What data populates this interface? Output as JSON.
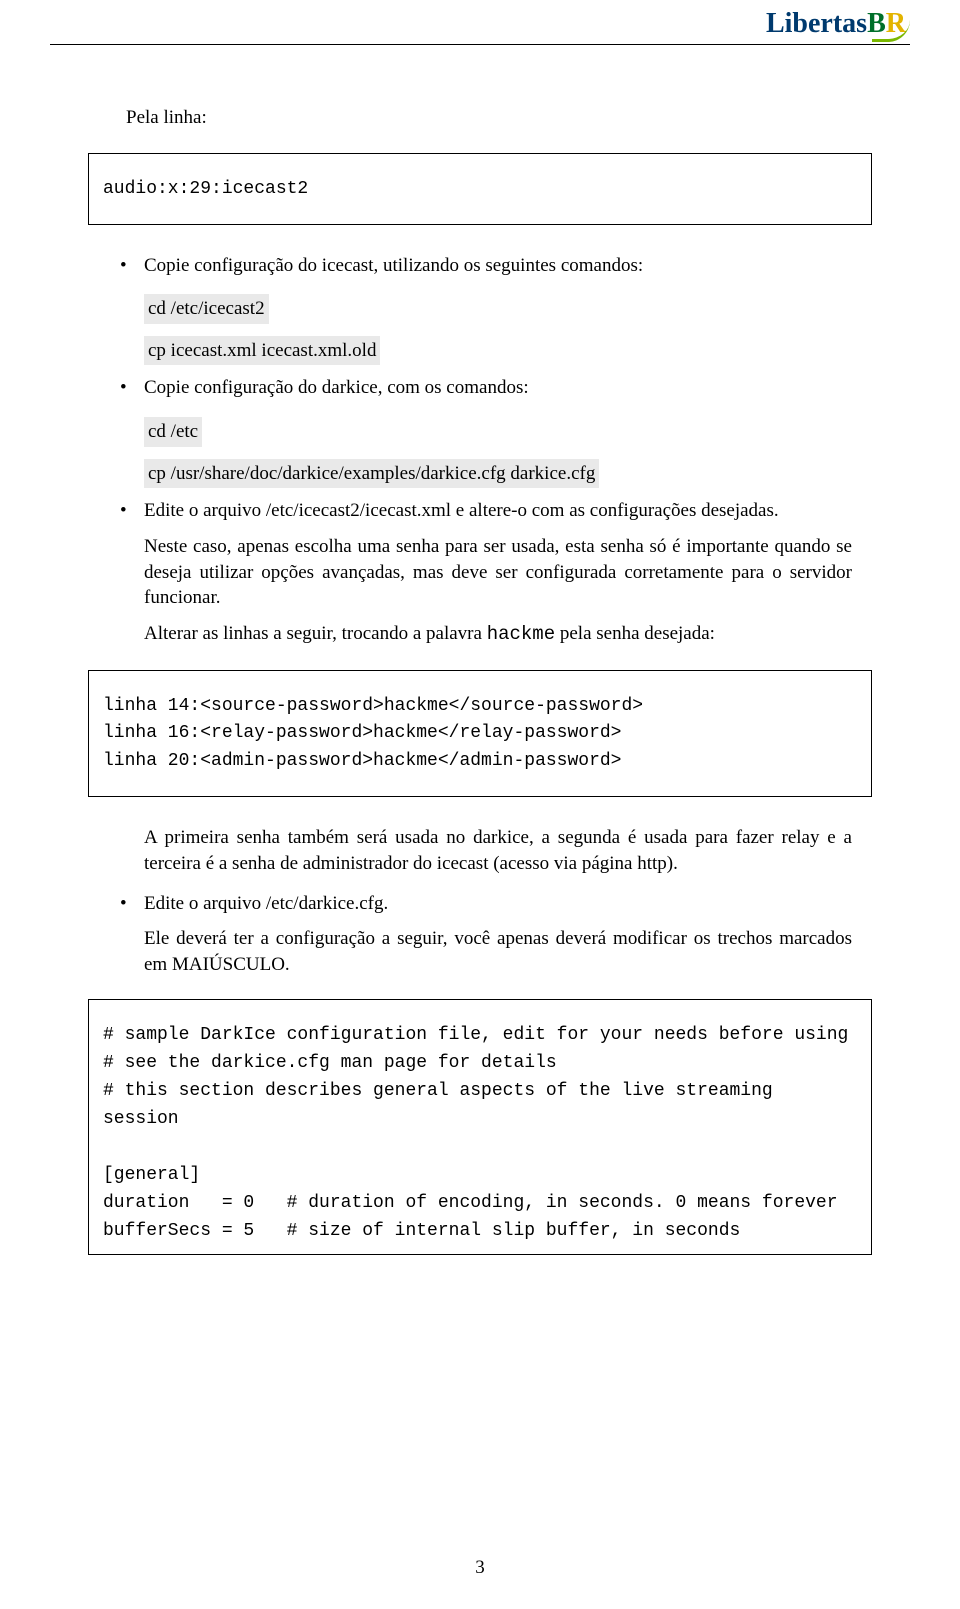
{
  "logo": {
    "part1": "Libertas",
    "part2_b": "B",
    "part2_r": "R"
  },
  "intro": "Pela linha:",
  "box1": "audio:x:29:icecast2",
  "items": {
    "i1": {
      "text": "Copie configuração do icecast, utilizando os seguintes comandos:",
      "cmd1": "cd /etc/icecast2",
      "cmd2": "cp icecast.xml icecast.xml.old"
    },
    "i2": {
      "text": "Copie configuração do darkice, com os comandos:",
      "cmd1": "cd /etc",
      "cmd2": "cp /usr/share/doc/darkice/examples/darkice.cfg darkice.cfg"
    },
    "i3": {
      "p1": "Edite o arquivo /etc/icecast2/icecast.xml e altere-o com as configurações desejadas.",
      "p2": "Neste caso, apenas escolha uma senha para ser usada, esta senha só é importante quando se deseja utilizar opções avançadas, mas deve ser configurada corretamente para o servidor funcionar.",
      "p3a": "Alterar as linhas a seguir, trocando a palavra ",
      "p3mono": "hackme",
      "p3b": " pela senha desejada:"
    }
  },
  "box2": "linha 14:<source-password>hackme</source-password>\nlinha 16:<relay-password>hackme</relay-password>\nlinha 20:<admin-password>hackme</admin-password>",
  "after_box2": "A primeira senha também será usada no darkice, a segunda é usada para fazer relay e a terceira é a senha de administrador do icecast (acesso via página http).",
  "items2": {
    "i4": {
      "p1": "Edite o arquivo /etc/darkice.cfg.",
      "p2": "Ele deverá ter a configuração a seguir, você apenas deverá modificar os trechos marcados em MAIÚSCULO."
    }
  },
  "box3": "# sample DarkIce configuration file, edit for your needs before using\n# see the darkice.cfg man page for details\n# this section describes general aspects of the live streaming session\n\n[general]\nduration   = 0   # duration of encoding, in seconds. 0 means forever\nbufferSecs = 5   # size of internal slip buffer, in seconds",
  "page_number": "3"
}
